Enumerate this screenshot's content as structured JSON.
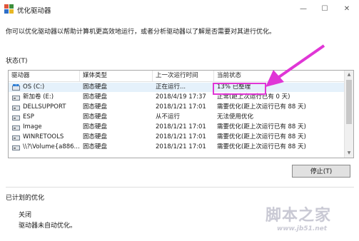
{
  "window": {
    "title": "优化驱动器",
    "controls": {
      "minimize": "—",
      "maximize": "☐",
      "close": "✕"
    }
  },
  "intro": "你可以优化驱动器以帮助计算机更高效地运行，或者分析驱动器以了解是否需要对其进行优化。",
  "status_label": "状态(T)",
  "table": {
    "columns": [
      "驱动器",
      "媒体类型",
      "上一次运行时间",
      "当前状态"
    ],
    "rows": [
      {
        "drive": "OS (C:)",
        "media": "固态硬盘",
        "last_run": "正在运行...",
        "status": "13% 已整理",
        "selected": true,
        "icon": "os-drive-icon"
      },
      {
        "drive": "新加卷 (E:)",
        "media": "固态硬盘",
        "last_run": "2018/4/19 17:37",
        "status": "正常(距上次运行已有 0 天)",
        "selected": false,
        "icon": "drive-icon"
      },
      {
        "drive": "DELLSUPPORT",
        "media": "固态硬盘",
        "last_run": "2018/1/21 17:01",
        "status": "需要优化(距上次运行已有 88 天)",
        "selected": false,
        "icon": "drive-icon"
      },
      {
        "drive": "ESP",
        "media": "固态硬盘",
        "last_run": "从不运行",
        "status": "无法使用优化",
        "selected": false,
        "icon": "drive-icon"
      },
      {
        "drive": "Image",
        "media": "固态硬盘",
        "last_run": "2018/1/21 17:01",
        "status": "需要优化(距上次运行已有 88 天)",
        "selected": false,
        "icon": "drive-icon"
      },
      {
        "drive": "WINRETOOLS",
        "media": "固态硬盘",
        "last_run": "2018/1/21 17:01",
        "status": "需要优化(距上次运行已有 88 天)",
        "selected": false,
        "icon": "drive-icon"
      },
      {
        "drive": "\\\\?\\Volume{a886...",
        "media": "固态硬盘",
        "last_run": "2018/1/21 17:01",
        "status": "需要优化(距上次运行已有 88 天)",
        "selected": false,
        "icon": "drive-icon"
      }
    ]
  },
  "stop_button": "停止(T)",
  "scheduled_label": "已计划的优化",
  "schedule": {
    "state": "关闭",
    "description": "驱动器未自动优化。"
  },
  "annotation": {
    "color": "#e036d6"
  },
  "watermark": {
    "logo": "脚本之家",
    "url": "www.jb51.net"
  }
}
